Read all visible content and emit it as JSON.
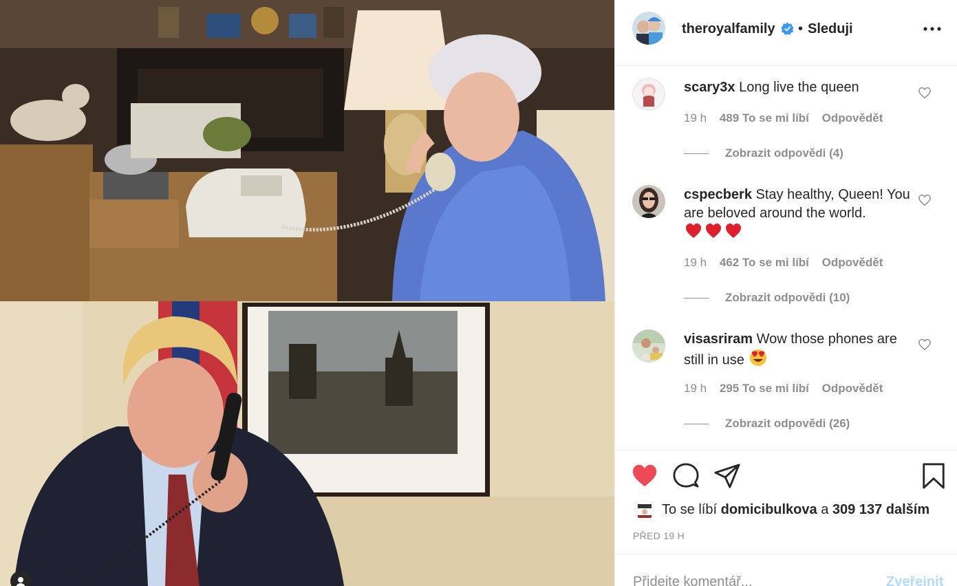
{
  "photo": {
    "top_scene": "queen-on-phone",
    "bottom_scene": "pm-on-phone"
  },
  "header": {
    "username": "theroyalfamily",
    "verified_icon": "verified-badge-icon",
    "separator": "•",
    "follow_status": "Sleduji",
    "more_icon": "more-options-icon"
  },
  "comments": [
    {
      "username": "scary3x",
      "text": "Long live the queen",
      "time": "19 h",
      "likes": "489 To se mi líbí",
      "reply": "Odpovědět",
      "view_replies": "Zobrazit odpovědi (4)"
    },
    {
      "username": "cspecberk",
      "text": "Stay healthy, Queen! You are beloved around the world.",
      "emoji": "❤️❤️❤️",
      "time": "19 h",
      "likes": "462 To se mi líbí",
      "reply": "Odpovědět",
      "view_replies": "Zobrazit odpovědi (10)"
    },
    {
      "username": "visasriram",
      "text": "Wow those phones are still in use",
      "emoji": "😍",
      "time": "19 h",
      "likes": "295 To se mi líbí",
      "reply": "Odpovědět",
      "view_replies": "Zobrazit odpovědi (26)"
    }
  ],
  "actions": {
    "like_icon": "heart-filled-icon",
    "comment_icon": "comment-icon",
    "share_icon": "share-icon",
    "save_icon": "bookmark-icon",
    "liked_by_prefix": "To se líbí",
    "liked_by_user": "domicibulkova",
    "liked_by_conj": "a",
    "liked_by_others": "309 137 dalším",
    "time_ago": "PŘED 19 H"
  },
  "add_comment": {
    "placeholder": "Přidejte komentář...",
    "post_label": "Zveřejnit"
  },
  "colors": {
    "like_red": "#ed4956",
    "muted": "#8e8e8e",
    "text": "#262626",
    "verified_blue": "#3897f0",
    "post_disabled": "#b3dbff"
  }
}
